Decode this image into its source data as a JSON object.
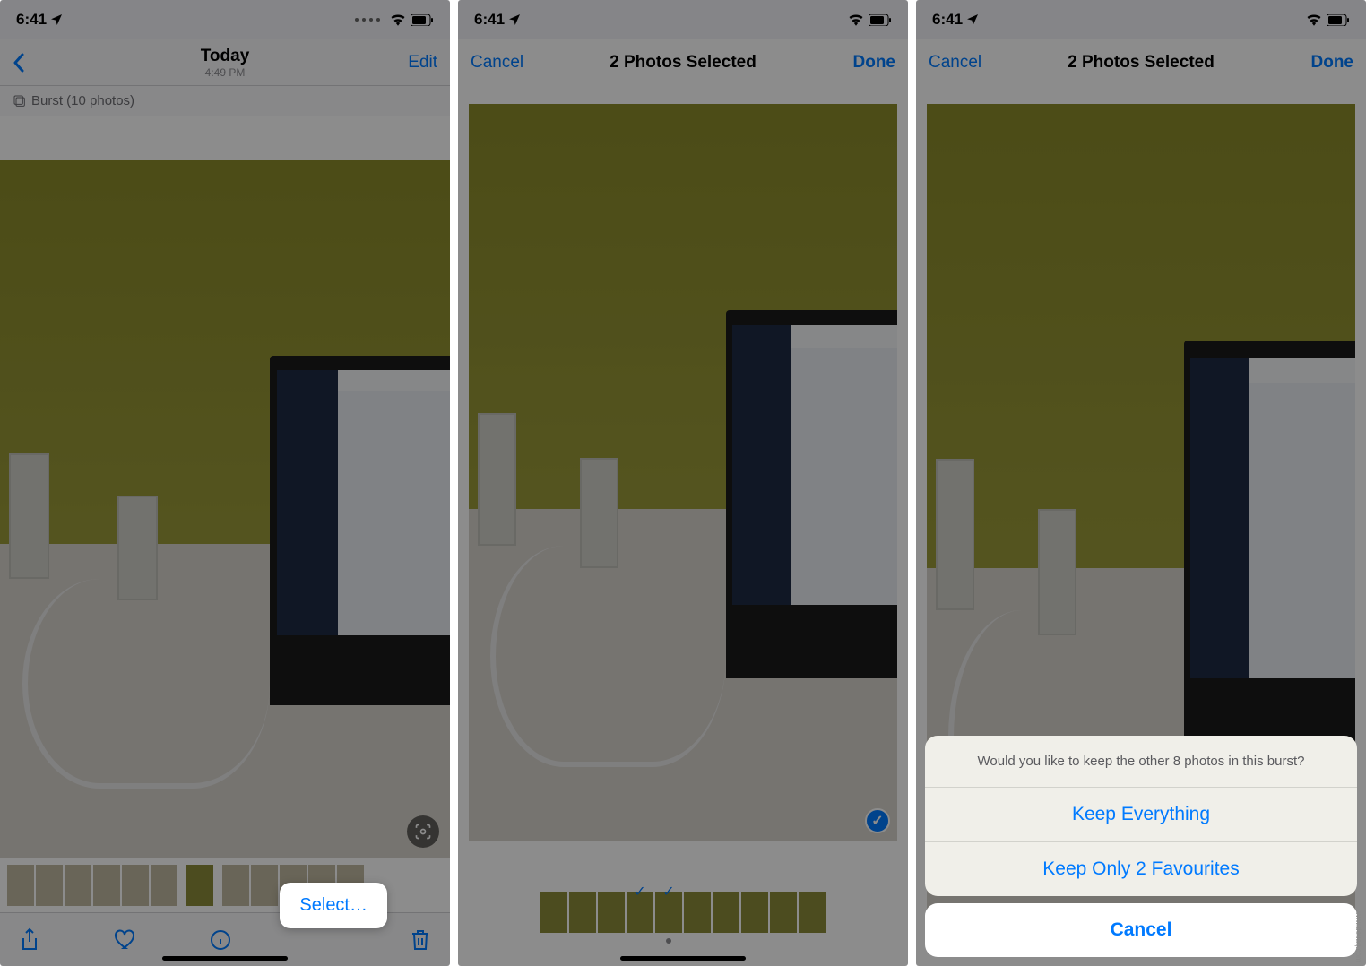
{
  "status_bar": {
    "time": "6:41",
    "location_icon": "location-arrow",
    "wifi_icon": "wifi",
    "battery_icon": "battery"
  },
  "screen1": {
    "nav": {
      "back_icon": "chevron-left",
      "title": "Today",
      "subtitle": "4:49 PM",
      "right": "Edit"
    },
    "burst_label": "Burst (10 photos)",
    "toolbar": {
      "share_icon": "share",
      "heart_icon": "heart",
      "info_icon": "info",
      "delete_icon": "trash"
    },
    "select_popup": "Select…"
  },
  "screen2": {
    "nav": {
      "left": "Cancel",
      "title": "2 Photos Selected",
      "right": "Done"
    },
    "check_icon": "checkmark"
  },
  "screen3": {
    "nav": {
      "left": "Cancel",
      "title": "2 Photos Selected",
      "right": "Done"
    },
    "sheet": {
      "message": "Would you like to keep the other 8 photos in this burst?",
      "option1": "Keep Everything",
      "option2": "Keep Only 2 Favourites",
      "cancel": "Cancel"
    }
  },
  "watermark": "www.deuaq.com"
}
